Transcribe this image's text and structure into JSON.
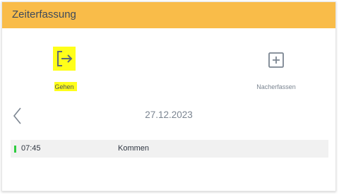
{
  "header": {
    "title": "Zeiterfassung"
  },
  "actions": {
    "gehen": {
      "label": "Gehen",
      "icon": "logout-icon",
      "highlight": "#ffff1a"
    },
    "nacherfassen": {
      "label": "Nacherfassen",
      "icon": "plus-box-icon"
    }
  },
  "date_nav": {
    "date": "27.12.2023",
    "prev_icon": "chevron-left-icon"
  },
  "entries": [
    {
      "time": "07:45",
      "type": "Kommen",
      "status_color": "#2ecc40"
    }
  ],
  "colors": {
    "header": "#f9bc49",
    "accent_text": "#3d4a5b"
  }
}
